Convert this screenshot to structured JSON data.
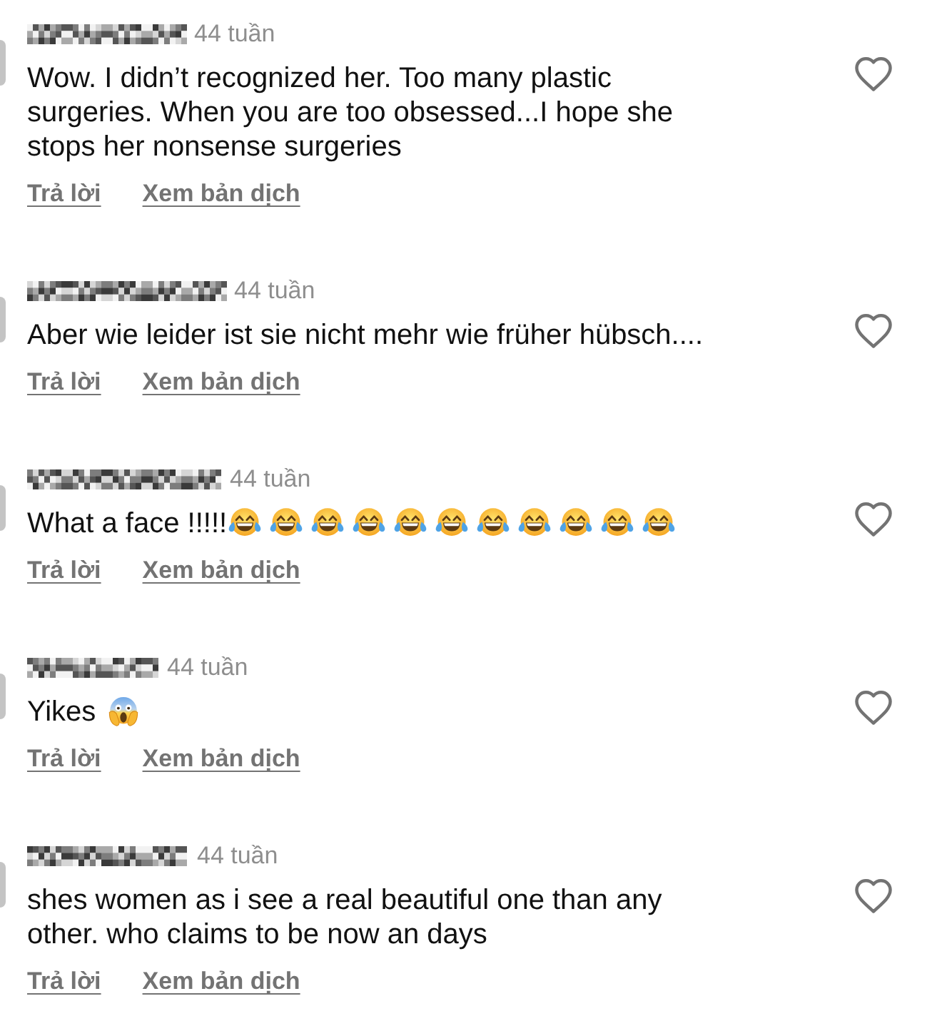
{
  "comments": [
    {
      "author": {
        "redacted": true
      },
      "time": "44 tuần",
      "text": "Wow. I didn’t recognized her. Too many plastic surgeries. When you are too obsessed...I hope she stops her nonsense surgeries",
      "liked": false,
      "actions": [
        "Trả lời",
        "Xem bản dịch"
      ]
    },
    {
      "author": {
        "redacted": true
      },
      "time": "44 tuần",
      "text": "Aber wie leider ist sie nicht mehr wie früher hübsch....",
      "liked": false,
      "actions": [
        "Trả lời",
        "Xem bản dịch"
      ]
    },
    {
      "author": {
        "redacted": true
      },
      "time": "44 tuần",
      "text": "What a face !!!!!",
      "emoji": [
        {
          "kind": "tears-of-joy"
        },
        {
          "kind": "tears-of-joy"
        },
        {
          "kind": "tears-of-joy"
        },
        {
          "kind": "tears-of-joy"
        },
        {
          "kind": "tears-of-joy"
        },
        {
          "kind": "tears-of-joy"
        },
        {
          "kind": "tears-of-joy"
        },
        {
          "kind": "tears-of-joy"
        },
        {
          "kind": "tears-of-joy"
        },
        {
          "kind": "tears-of-joy"
        },
        {
          "kind": "tears-of-joy"
        }
      ],
      "liked": false,
      "actions": [
        "Trả lời",
        "Xem bản dịch"
      ]
    },
    {
      "author": {
        "redacted": true
      },
      "time": "44 tuần",
      "text": "Yikes",
      "emoji": [
        {
          "kind": "screaming"
        }
      ],
      "liked": false,
      "actions": [
        "Trả lời",
        "Xem bản dịch"
      ]
    },
    {
      "author": {
        "redacted": true
      },
      "time": "44 tuần",
      "text": "shes women as i see a real beautiful one than any other. who claims to be now an days",
      "liked": false,
      "actions": [
        "Trả lời",
        "Xem bản dịch"
      ]
    }
  ]
}
